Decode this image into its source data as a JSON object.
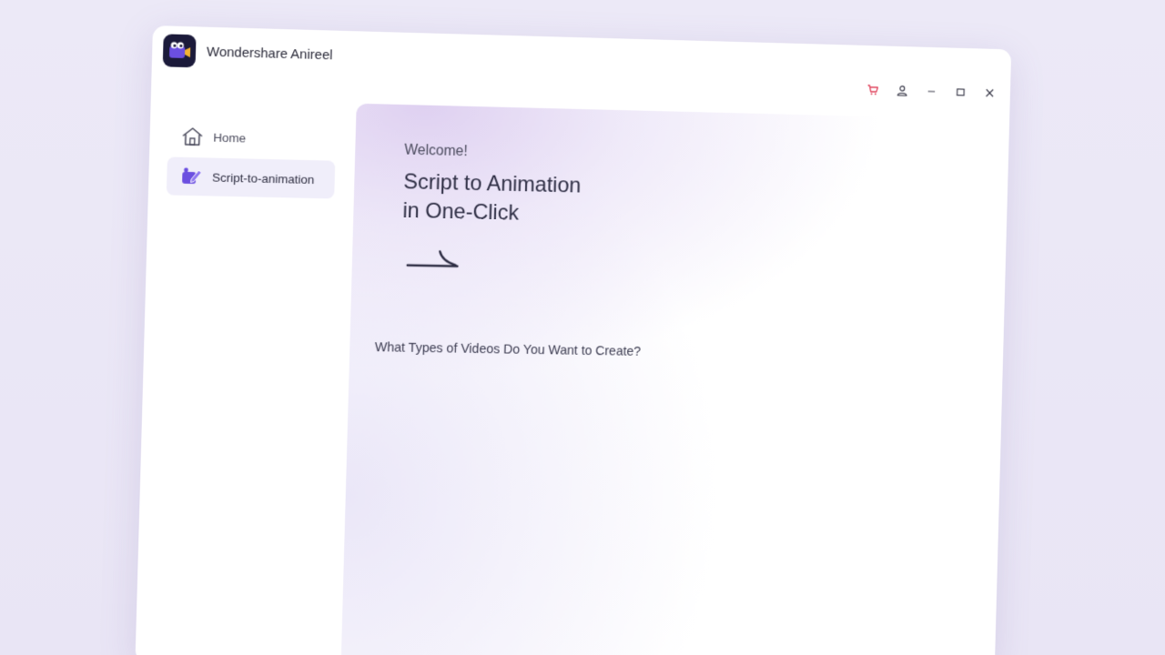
{
  "app": {
    "title": "Wondershare Anireel",
    "logo_icon": "anireel-logo-icon",
    "accent": "#6b4fe0",
    "logo_bg": "#1b1a3a"
  },
  "window_controls": {
    "cart_icon": "cart-icon",
    "account_icon": "user-icon",
    "minimize_icon": "minimize-icon",
    "maximize_icon": "maximize-icon",
    "close_icon": "close-icon",
    "cart_color": "#e0405a"
  },
  "sidebar": {
    "items": [
      {
        "label": "Home",
        "icon": "home-icon",
        "active": false
      },
      {
        "label": "Script-to-animation",
        "icon": "script-to-animation-icon",
        "active": true
      }
    ]
  },
  "main": {
    "welcome": "Welcome!",
    "headline_line1": "Script to Animation",
    "headline_line2": "in One-Click",
    "section_question": "What Types of Videos Do You Want to Create?"
  }
}
